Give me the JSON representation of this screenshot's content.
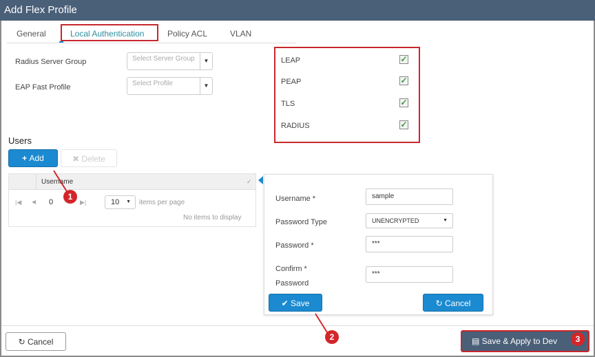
{
  "dialog": {
    "title": "Add Flex Profile"
  },
  "tabs": [
    {
      "label": "General"
    },
    {
      "label": "Local Authentication"
    },
    {
      "label": "Policy ACL"
    },
    {
      "label": "VLAN"
    }
  ],
  "fields": {
    "radius_label": "Radius Server Group",
    "radius_placeholder": "Select Server Group",
    "eap_label": "EAP Fast Profile",
    "eap_placeholder": "Select Profile"
  },
  "methods": [
    {
      "label": "LEAP",
      "checked": true
    },
    {
      "label": "PEAP",
      "checked": true
    },
    {
      "label": "TLS",
      "checked": true
    },
    {
      "label": "RADIUS",
      "checked": true
    }
  ],
  "users": {
    "heading": "Users",
    "add_label": "Add",
    "delete_label": "Delete",
    "column": "Username",
    "page": "0",
    "per_page": "10",
    "per_page_label": "items per page",
    "empty": "No items to display"
  },
  "form": {
    "username_label": "Username *",
    "username_value": "sample",
    "ptype_label": "Password Type",
    "ptype_value": "UNENCRYPTED",
    "password_label": "Password *",
    "password_value": "***",
    "confirm_label1": "Confirm *",
    "confirm_label2": "Password",
    "confirm_value": "***",
    "save_label": "Save",
    "cancel_label": "Cancel"
  },
  "footer": {
    "cancel_label": "Cancel",
    "apply_label": "Save & Apply to Dev"
  },
  "callouts": [
    "1",
    "2",
    "3"
  ]
}
